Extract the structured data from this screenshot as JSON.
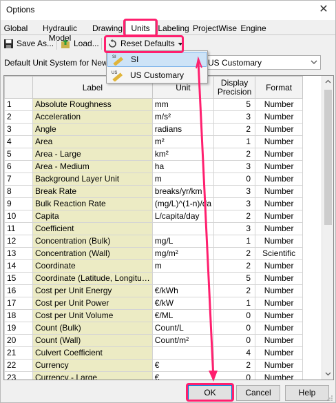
{
  "window": {
    "title": "Options",
    "close_glyph": "✕"
  },
  "tabs": [
    {
      "label": "Global"
    },
    {
      "label": "Hydraulic Model"
    },
    {
      "label": "Drawing"
    },
    {
      "label": "Units"
    },
    {
      "label": "Labeling"
    },
    {
      "label": "ProjectWise"
    },
    {
      "label": "Engine"
    }
  ],
  "active_tab": "Units",
  "toolbar": {
    "save_as": "Save As...",
    "load": "Load...",
    "reset_defaults": "Reset Defaults"
  },
  "default_unit": {
    "label": "Default Unit System for New H",
    "value": "US Customary"
  },
  "dropdown": {
    "items": [
      {
        "label": "SI",
        "icon": "si-ruler-icon",
        "highlighted": true
      },
      {
        "label": "US Customary",
        "icon": "us-ruler-icon",
        "highlighted": false
      }
    ]
  },
  "grid": {
    "columns": [
      "",
      "Label",
      "Unit",
      "Display\nPrecision",
      "Format"
    ],
    "rows": [
      [
        "1",
        "Absolute Roughness",
        "mm",
        "5",
        "Number"
      ],
      [
        "2",
        "Acceleration",
        "m/s²",
        "3",
        "Number"
      ],
      [
        "3",
        "Angle",
        "radians",
        "2",
        "Number"
      ],
      [
        "4",
        "Area",
        "m²",
        "1",
        "Number"
      ],
      [
        "5",
        "Area - Large",
        "km²",
        "2",
        "Number"
      ],
      [
        "6",
        "Area - Medium",
        "ha",
        "3",
        "Number"
      ],
      [
        "7",
        "Background Layer Unit",
        "m",
        "0",
        "Number"
      ],
      [
        "8",
        "Break Rate",
        "breaks/yr/km",
        "3",
        "Number"
      ],
      [
        "9",
        "Bulk Reaction Rate",
        "(mg/L)^(1-n)/da",
        "3",
        "Number"
      ],
      [
        "10",
        "Capita",
        "L/capita/day",
        "2",
        "Number"
      ],
      [
        "11",
        "Coefficient",
        "",
        "3",
        "Number"
      ],
      [
        "12",
        "Concentration (Bulk)",
        "mg/L",
        "1",
        "Number"
      ],
      [
        "13",
        "Concentration (Wall)",
        "mg/m²",
        "2",
        "Scientific"
      ],
      [
        "14",
        "Coordinate",
        "m",
        "2",
        "Number"
      ],
      [
        "15",
        "Coordinate (Latitude, Longitu…",
        "",
        "5",
        "Number"
      ],
      [
        "16",
        "Cost per Unit Energy",
        "€/kWh",
        "2",
        "Number"
      ],
      [
        "17",
        "Cost per Unit Power",
        "€/kW",
        "1",
        "Number"
      ],
      [
        "18",
        "Cost per Unit Volume",
        "€/ML",
        "0",
        "Number"
      ],
      [
        "19",
        "Count (Bulk)",
        "Count/L",
        "0",
        "Number"
      ],
      [
        "20",
        "Count (Wall)",
        "Count/m²",
        "0",
        "Number"
      ],
      [
        "21",
        "Culvert Coefficient",
        "",
        "4",
        "Number"
      ],
      [
        "22",
        "Currency",
        "€",
        "2",
        "Number"
      ],
      [
        "23",
        "Currency - Large",
        "€",
        "0",
        "Number"
      ]
    ]
  },
  "buttons": {
    "ok": "OK",
    "cancel": "Cancel",
    "help": "Help"
  },
  "colors": {
    "highlight": "#ff1f6e",
    "label_cell": "#ecebc4",
    "selection": "#cde3f7"
  }
}
